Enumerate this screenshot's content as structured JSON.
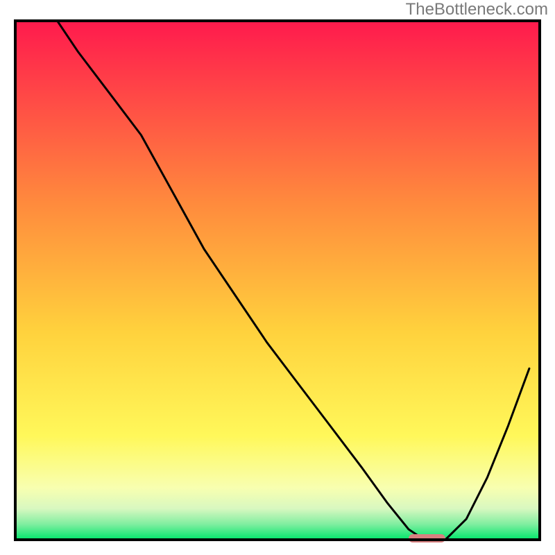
{
  "watermark": "TheBottleneck.com",
  "colors": {
    "gradient_top": "#ff1a4d",
    "gradient_mid1": "#ff6b3d",
    "gradient_mid2": "#ffb83d",
    "gradient_mid3": "#ffe03d",
    "gradient_pale_yellow": "#ffffa8",
    "gradient_pale_green": "#c8f8c8",
    "gradient_green": "#00e66b",
    "curve_stroke": "#000000",
    "marker_fill": "#d88080",
    "frame_stroke": "#000000"
  },
  "chart_data": {
    "type": "line",
    "title": "",
    "xlabel": "",
    "ylabel": "",
    "xlim": [
      0,
      100
    ],
    "ylim": [
      0,
      100
    ],
    "series": [
      {
        "name": "bottleneck-curve",
        "x": [
          8,
          12,
          18,
          24,
          30,
          36,
          42,
          48,
          54,
          60,
          66,
          71,
          75,
          78,
          82,
          86,
          90,
          94,
          98
        ],
        "y": [
          100,
          94,
          86,
          78,
          67,
          56,
          47,
          38,
          30,
          22,
          14,
          7,
          2,
          0,
          0,
          4,
          12,
          22,
          33
        ]
      }
    ],
    "marker": {
      "name": "optimal-range",
      "x_start": 75,
      "x_end": 82,
      "y": 0
    },
    "background_gradient": {
      "stops": [
        {
          "offset": 0.0,
          "color": "#ff1a4d"
        },
        {
          "offset": 0.35,
          "color": "#ff8a3d"
        },
        {
          "offset": 0.6,
          "color": "#ffd23d"
        },
        {
          "offset": 0.8,
          "color": "#fff85a"
        },
        {
          "offset": 0.9,
          "color": "#f8ffb0"
        },
        {
          "offset": 0.94,
          "color": "#d8f8c0"
        },
        {
          "offset": 0.97,
          "color": "#80eea0"
        },
        {
          "offset": 1.0,
          "color": "#00e66b"
        }
      ]
    }
  }
}
